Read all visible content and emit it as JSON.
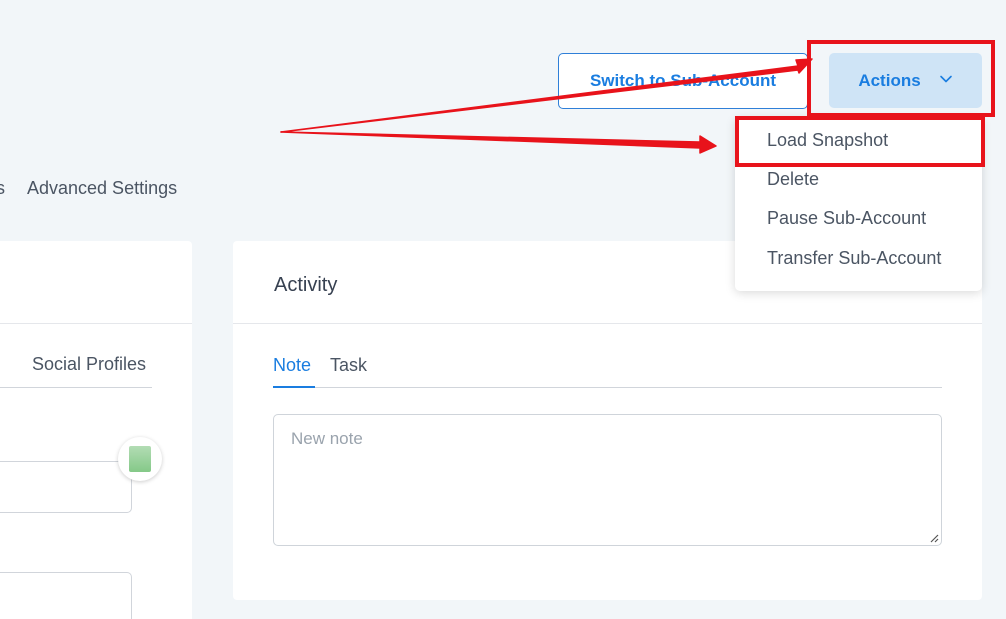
{
  "header": {
    "switch_label": "Switch to Sub-Account",
    "actions_label": "Actions"
  },
  "tabs_fragment": {
    "cut_text": "s",
    "advanced_label": "Advanced Settings"
  },
  "left_card": {
    "social_label": "Social Profiles"
  },
  "activity": {
    "title": "Activity",
    "tabs": [
      {
        "label": "Note",
        "active": true
      },
      {
        "label": "Task",
        "active": false
      }
    ],
    "note_placeholder": "New note"
  },
  "actions_menu": {
    "items": [
      {
        "label": "Load Snapshot"
      },
      {
        "label": "Delete"
      },
      {
        "label": "Pause Sub-Account"
      },
      {
        "label": "Transfer Sub-Account"
      }
    ]
  },
  "icons": {
    "dropdown": "chevron-down-icon",
    "resize": "resize-handle-icon",
    "avatar": "contact-avatar-icon"
  },
  "colors": {
    "primary": "#1a7de0",
    "actions_bg": "#cfe4f6",
    "page_bg": "#f2f6f9",
    "annotation": "#e8131b"
  }
}
